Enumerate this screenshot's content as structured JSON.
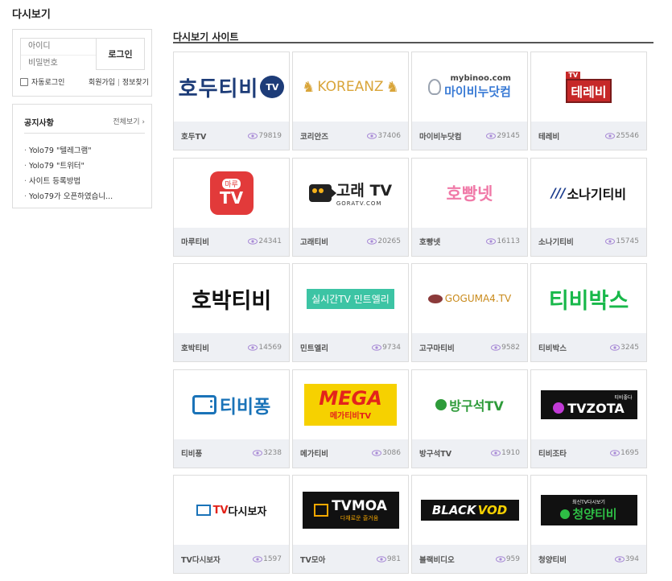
{
  "page": {
    "title": "다시보기"
  },
  "login": {
    "id_placeholder": "아이디",
    "pw_placeholder": "비밀번호",
    "button": "로그인",
    "auto_login": "자동로그인",
    "signup": "회원가입",
    "separator": "|",
    "find_info": "정보찾기"
  },
  "notice": {
    "title": "공지사항",
    "more": "전체보기 ›",
    "items": [
      "Yolo79 \"텔레그램\"",
      "Yolo79 \"트위터\"",
      "사이트 등록방법",
      "Yolo79가 오픈하였습니..."
    ]
  },
  "section": {
    "title": "다시보기 사이트"
  },
  "sites": [
    {
      "name": "호두TV",
      "views": "79819",
      "logo_text": "호두티비",
      "logo_sub": "TV"
    },
    {
      "name": "코리안즈",
      "views": "37406",
      "logo_text": "KOREANZ"
    },
    {
      "name": "마이비누닷컴",
      "views": "29145",
      "logo_text": "마이비누닷컴",
      "logo_sub": "mybinoo.com"
    },
    {
      "name": "테레비",
      "views": "25546",
      "logo_text": "테레비",
      "logo_sub": "TV"
    },
    {
      "name": "마루티비",
      "views": "24341",
      "logo_text": "TV",
      "logo_sub": "마루"
    },
    {
      "name": "고래티비",
      "views": "20265",
      "logo_text": "고래 TV",
      "logo_sub": "GORATV.COM"
    },
    {
      "name": "호빵넷",
      "views": "16113",
      "logo_text": "호빵넷"
    },
    {
      "name": "소나기티비",
      "views": "15745",
      "logo_text": "소나기티비",
      "logo_sub": "///"
    },
    {
      "name": "호박티비",
      "views": "14569",
      "logo_text": "호박티비"
    },
    {
      "name": "민트엘리",
      "views": "9734",
      "logo_text": "실시간TV 민트엘리"
    },
    {
      "name": "고구마티비",
      "views": "9582",
      "logo_text": "GOGUMA4.TV"
    },
    {
      "name": "티비박스",
      "views": "3245",
      "logo_text": "티비박스"
    },
    {
      "name": "티비퐁",
      "views": "3238",
      "logo_text": "티비퐁"
    },
    {
      "name": "메가티비",
      "views": "3086",
      "logo_text": "MEGA",
      "logo_sub": "메가티비TV"
    },
    {
      "name": "방구석TV",
      "views": "1910",
      "logo_text": "방구석TV"
    },
    {
      "name": "티비조타",
      "views": "1695",
      "logo_text": "TVZOTA",
      "logo_sub": "티비좋다"
    },
    {
      "name": "TV다시보자",
      "views": "1597",
      "logo_text": "다시보자",
      "logo_sub": "TV"
    },
    {
      "name": "TV모아",
      "views": "981",
      "logo_text": "TVMOA",
      "logo_sub": "다채로운 즐거움"
    },
    {
      "name": "블랙비디오",
      "views": "959",
      "logo_text": "BLACK",
      "logo_sub": "VOD"
    },
    {
      "name": "청양티비",
      "views": "394",
      "logo_text": "청양티비",
      "logo_sub": "최신TV다시보기"
    }
  ],
  "colors": {
    "footer_bg": "#eef0f4",
    "eye_icon": "#a88ad6",
    "hodu_navy": "#1d3c78",
    "mint": "#3cc4a4",
    "tvbox_green": "#18b84a",
    "tvpong_blue": "#1a73b8",
    "maru_red": "#e23a3a"
  }
}
